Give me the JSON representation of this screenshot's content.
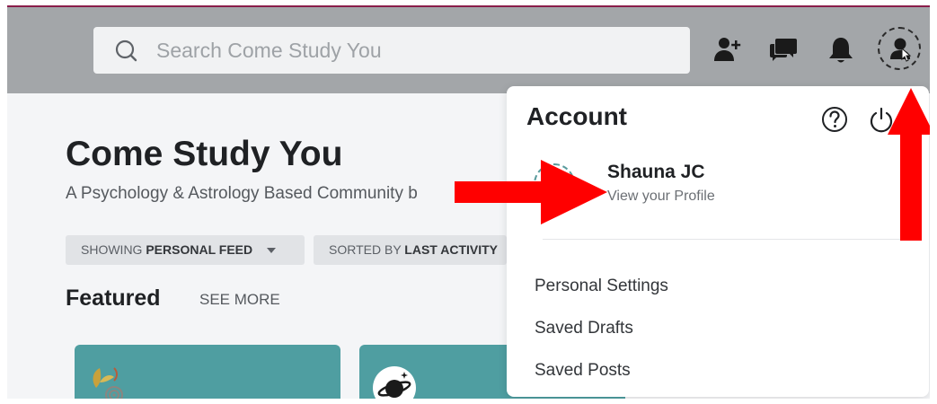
{
  "header": {
    "search_placeholder": "Search Come Study You",
    "icons": [
      "search-icon",
      "add-user-icon",
      "chat-icon",
      "bell-icon",
      "user-avatar-icon"
    ]
  },
  "community": {
    "title": "Come Study You",
    "tagline": "A Psychology & Astrology Based Community b"
  },
  "filters": {
    "showing_prefix": "SHOWING",
    "showing_value": "PERSONAL FEED",
    "sorted_prefix": "SORTED BY",
    "sorted_value": "LAST ACTIVITY"
  },
  "featured": {
    "heading": "Featured",
    "see_more": "SEE MORE"
  },
  "account_menu": {
    "title": "Account",
    "user_name": "Shauna JC",
    "profile_link": "View your Profile",
    "items": [
      {
        "label": "Personal Settings"
      },
      {
        "label": "Saved Drafts"
      },
      {
        "label": "Saved Posts"
      }
    ]
  },
  "colors": {
    "topbar": "#a3a6a9",
    "card_teal": "#4f9ea1",
    "annotation_arrow": "#ff0000"
  }
}
